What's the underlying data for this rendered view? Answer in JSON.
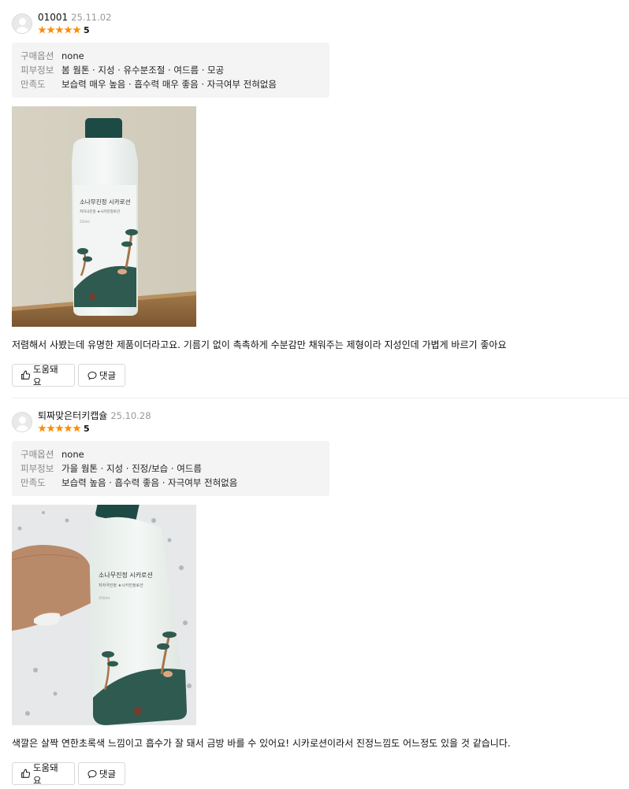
{
  "reviews": [
    {
      "nickname": "01001",
      "date": "25.11.02",
      "rating": 5,
      "score_label": "5",
      "info": [
        {
          "key": "구매옵션",
          "value": "none"
        },
        {
          "key": "피부정보",
          "value": "봄 웜톤 · 지성 · 유수분조절 · 여드름 · 모공"
        },
        {
          "key": "만족도",
          "value": "보습력 매우 높음 · 흡수력 매우 좋음 · 자극여부 전혀없음"
        }
      ],
      "photo_label_main": "소나무진정 시카로션",
      "photo_label_sub": "저자극진정 ★시카진정로션",
      "photo_label_vol": "250ml",
      "text": "저렴해서 사봤는데 유명한 제품이더라고요. 기름기 없이 촉촉하게 수분감만 채워주는 제형이라 지성인데 가볍게 바르기 좋아요",
      "helpful_label": "도움돼요",
      "comment_label": "댓글"
    },
    {
      "nickname": "퇴짜맞은터키캡슐",
      "date": "25.10.28",
      "rating": 5,
      "score_label": "5",
      "info": [
        {
          "key": "구매옵션",
          "value": "none"
        },
        {
          "key": "피부정보",
          "value": "가을 웜톤 · 지성 · 진정/보습 · 여드름"
        },
        {
          "key": "만족도",
          "value": "보습력 높음 · 흡수력 좋음 · 자극여부 전혀없음"
        }
      ],
      "photo_label_main": "소나무진정 시카로션",
      "photo_label_sub": "저자극진정 ★시카진정로션",
      "photo_label_vol": "250ml",
      "text": "색깔은 살짝 연한초록색 느낌이고 흡수가 잘 돼서 금방 바를 수 있어요! 시카로션이라서 진정느낌도 어느정도 있을 것 같습니다.",
      "helpful_label": "도움돼요",
      "comment_label": "댓글"
    }
  ],
  "colors": {
    "star": "#ff8a00",
    "info_bg": "#f4f4f4",
    "muted": "#999999",
    "bottle_cap": "#1d4a44",
    "hill": "#2f5a4f"
  }
}
